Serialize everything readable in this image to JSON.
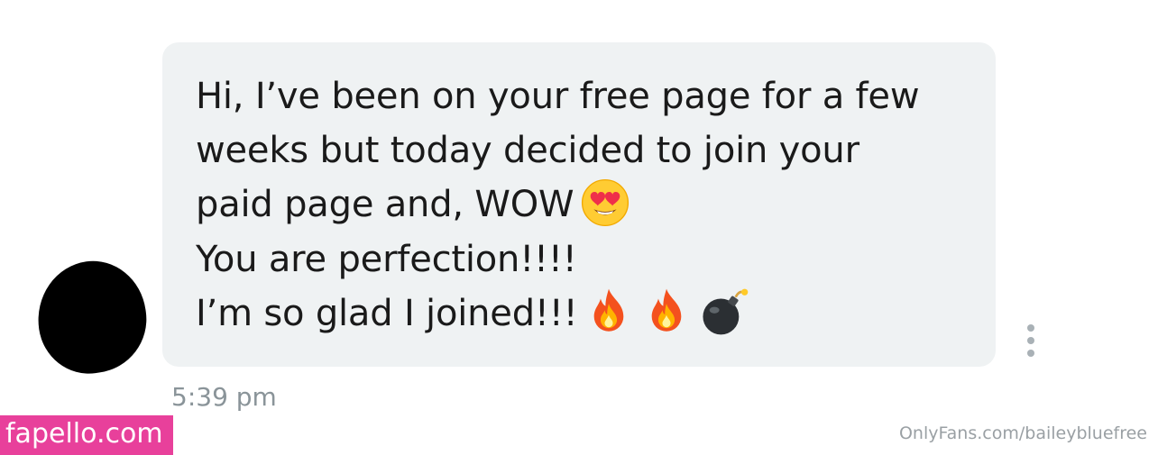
{
  "conversation": {
    "message": {
      "lines": [
        "Hi, I’ve been on your free page for a few",
        "weeks but today decided to join your",
        "paid page and, WOW",
        "You are perfection!!!!",
        "I’m so glad I joined!!!"
      ],
      "emojis": {
        "line3": [
          "smiling-face-with-heart-eyes"
        ],
        "line5": [
          "fire",
          "fire",
          "bomb"
        ]
      },
      "timestamp": "5:39 pm"
    },
    "colors": {
      "bubble_background": "#eff2f3",
      "message_text": "#1a1a1a",
      "timestamp_text": "#8a9499",
      "menu_dots": "#a9b1b6"
    }
  },
  "watermarks": {
    "left": {
      "text": "fapello.com",
      "background": "#e8409b"
    },
    "right": {
      "text": "OnlyFans.com/baileybluefree"
    }
  }
}
